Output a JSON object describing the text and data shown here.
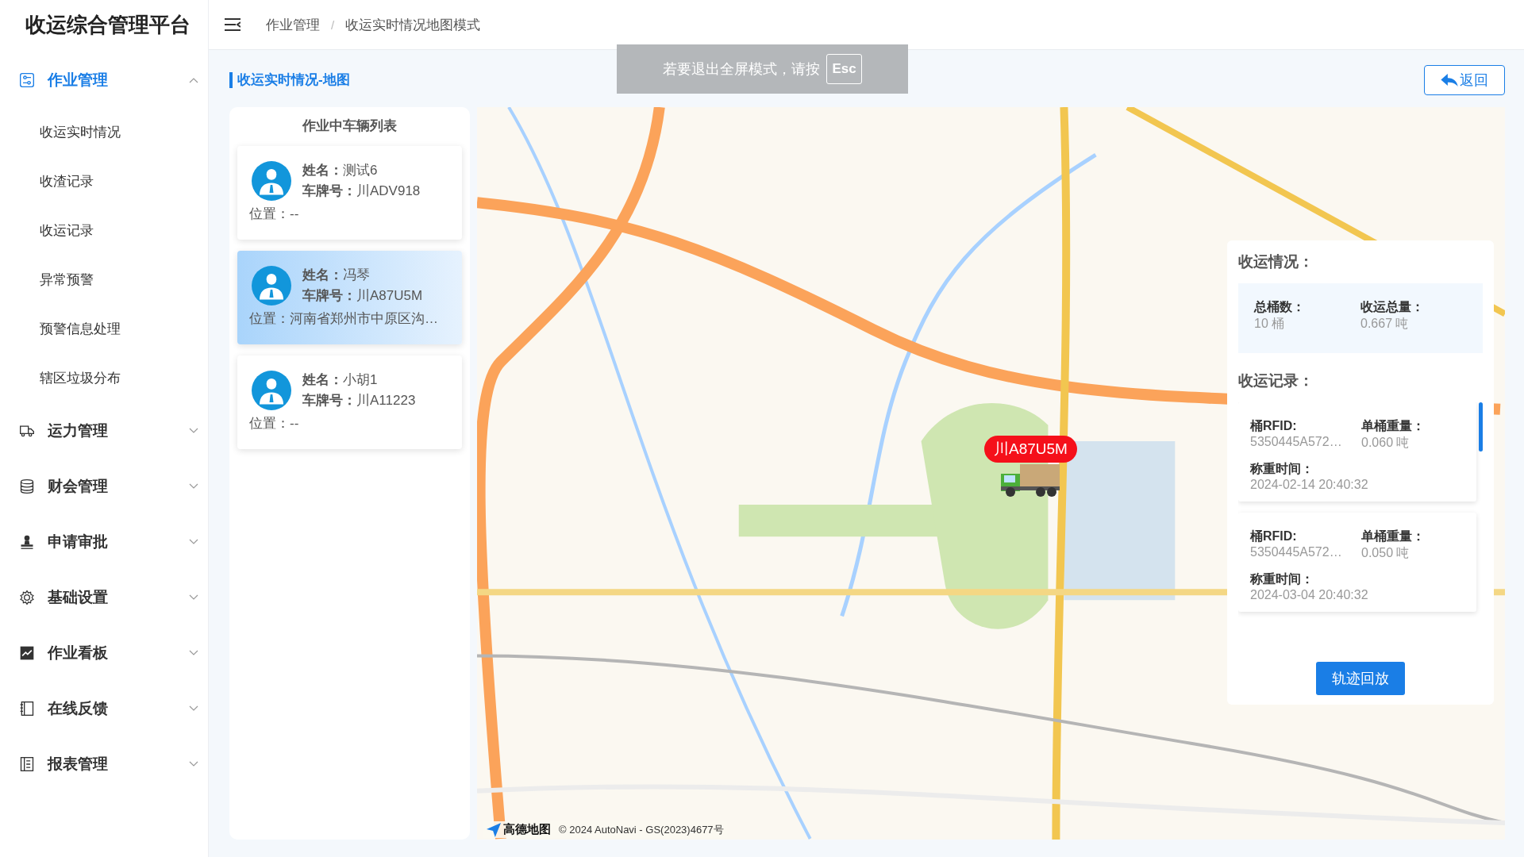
{
  "app": {
    "title": "收运综合管理平台"
  },
  "sidebar": {
    "items": [
      {
        "label": "作业管理",
        "selected": true,
        "expanded": true,
        "children": [
          {
            "label": "收运实时情况"
          },
          {
            "label": "收渣记录"
          },
          {
            "label": "收运记录"
          },
          {
            "label": "异常预警"
          },
          {
            "label": "预警信息处理"
          },
          {
            "label": "辖区垃圾分布"
          }
        ]
      },
      {
        "label": "运力管理",
        "selected": false,
        "expanded": false
      },
      {
        "label": "财会管理",
        "selected": false,
        "expanded": false
      },
      {
        "label": "申请审批",
        "selected": false,
        "expanded": false
      },
      {
        "label": "基础设置",
        "selected": false,
        "expanded": false
      },
      {
        "label": "作业看板",
        "selected": false,
        "expanded": false
      },
      {
        "label": "在线反馈",
        "selected": false,
        "expanded": false
      },
      {
        "label": "报表管理",
        "selected": false,
        "expanded": false
      }
    ]
  },
  "breadcrumb": {
    "items": [
      "作业管理",
      "收运实时情况地图模式"
    ],
    "separator": "/"
  },
  "fullscreen_notice": {
    "text": "若要退出全屏模式，请按",
    "key": "Esc"
  },
  "page": {
    "title": "收运实时情况-地图",
    "back_button": "返回"
  },
  "vehicle_list": {
    "title": "作业中车辆列表",
    "vehicles": [
      {
        "name_label": "姓名：",
        "name": "测试6",
        "plate_label": "车牌号：",
        "plate": "川ADV918",
        "location_label": "位置：",
        "location": "--",
        "selected": false
      },
      {
        "name_label": "姓名：",
        "name": "冯琴",
        "plate_label": "车牌号：",
        "plate": "川A87U5M",
        "location_label": "位置：",
        "location": "河南省郑州市中原区沟…",
        "selected": true
      },
      {
        "name_label": "姓名：",
        "name": "小胡1",
        "plate_label": "车牌号：",
        "plate": "川A11223",
        "location_label": "位置：",
        "location": "--",
        "selected": false
      }
    ]
  },
  "map": {
    "kind": "picture",
    "marker": {
      "plate": "川A87U5M"
    },
    "attribution": {
      "logo": "高德地图",
      "copyright": "© 2024 AutoNavi - GS(2023)4677号"
    }
  },
  "info_panel": {
    "summary_title": "收运情况：",
    "summary": [
      {
        "label": "总桶数：",
        "value": "10 桶"
      },
      {
        "label": "收运总量：",
        "value": "0.667 吨"
      }
    ],
    "records_title": "收运记录：",
    "records": [
      {
        "fields": [
          {
            "label": "桶RFID:",
            "value": "5350445A572…"
          },
          {
            "label": "单桶重量：",
            "value": "0.060 吨"
          },
          {
            "label": "称重时间：",
            "value": "2024-02-14 20:40:32"
          }
        ]
      },
      {
        "fields": [
          {
            "label": "桶RFID:",
            "value": "5350445A572…"
          },
          {
            "label": "单桶重量：",
            "value": "0.050 吨"
          },
          {
            "label": "称重时间：",
            "value": "2024-03-04 20:40:32"
          }
        ]
      }
    ],
    "replay_button": "轨迹回放"
  }
}
